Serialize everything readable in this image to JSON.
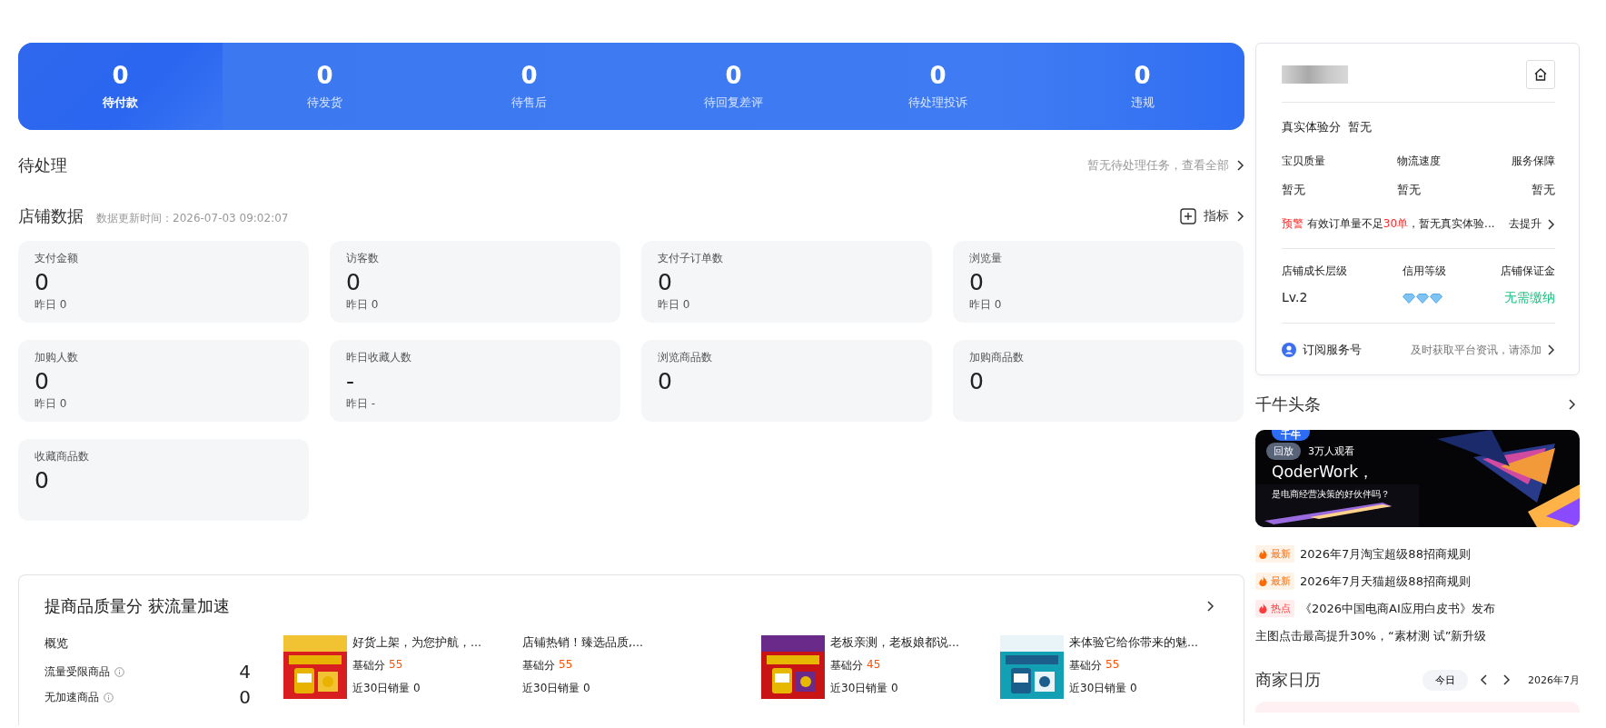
{
  "summary": [
    {
      "value": "0",
      "label": "待付款",
      "selected": true
    },
    {
      "value": "0",
      "label": "待发货",
      "selected": false
    },
    {
      "value": "0",
      "label": "待售后",
      "selected": false
    },
    {
      "value": "0",
      "label": "待回复差评",
      "selected": false
    },
    {
      "value": "0",
      "label": "待处理投诉",
      "selected": false
    },
    {
      "value": "0",
      "label": "违规",
      "selected": false
    }
  ],
  "pending": {
    "title": "待处理",
    "link": "暂无待处理任务，查看全部"
  },
  "store_data": {
    "title": "店铺数据",
    "updated": "数据更新时间：2026-07-03 09:02:07",
    "metric_button": "指标"
  },
  "metrics": [
    {
      "label": "支付金额",
      "value": "0",
      "yesterday": "昨日 0"
    },
    {
      "label": "访客数",
      "value": "0",
      "yesterday": "昨日 0"
    },
    {
      "label": "支付子订单数",
      "value": "0",
      "yesterday": "昨日 0"
    },
    {
      "label": "浏览量",
      "value": "0",
      "yesterday": "昨日 0"
    },
    {
      "label": "加购人数",
      "value": "0",
      "yesterday": "昨日 0"
    },
    {
      "label": "昨日收藏人数",
      "value": "-",
      "yesterday": "昨日 -"
    },
    {
      "label": "浏览商品数",
      "value": "0"
    },
    {
      "label": "加购商品数",
      "value": "0"
    },
    {
      "label": "收藏商品数",
      "value": "0"
    }
  ],
  "quality": {
    "title": "提商品质量分 获流量加速",
    "overview_title": "概览",
    "overview": [
      {
        "label": "流量受限商品",
        "value": "4"
      },
      {
        "label": "无加速商品",
        "value": "0"
      }
    ],
    "products": [
      {
        "title": "好货上架，为您护航，...",
        "score_label": "基础分",
        "score": "55",
        "sales": "近30日销量 0"
      },
      {
        "title": "店铺热销！臻选品质,...",
        "score_label": "基础分",
        "score": "55",
        "sales": "近30日销量 0"
      },
      {
        "title": "老板亲测，老板娘都说...",
        "score_label": "基础分",
        "score": "45",
        "sales": "近30日销量 0"
      },
      {
        "title": "来体验它给你带来的魅...",
        "score_label": "基础分",
        "score": "55",
        "sales": "近30日销量 0"
      }
    ]
  },
  "profile": {
    "experience_label": "真实体验分",
    "experience_value": "暂无",
    "scores": [
      {
        "label": "宝贝质量",
        "value": "暂无"
      },
      {
        "label": "物流速度",
        "value": "暂无"
      },
      {
        "label": "服务保障",
        "value": "暂无"
      }
    ],
    "warning": {
      "tag": "预警",
      "text_before": "有效订单量不足",
      "highlight": "30单",
      "text_after": "，暂无真实体验...",
      "action": "去提升"
    },
    "levels": [
      {
        "label": "店铺成长层级",
        "value": "Lv.2",
        "kind": "text"
      },
      {
        "label": "信用等级",
        "kind": "diamonds",
        "stars": 3
      },
      {
        "label": "店铺保证金",
        "value": "无需缴纳",
        "kind": "status"
      }
    ],
    "subscribe": {
      "label": "订阅服务号",
      "hint": "及时获取平台资讯，请添加"
    }
  },
  "headlines": {
    "title": "千牛头条",
    "banner": {
      "logo": "千牛",
      "badge": "回放",
      "viewers": "3万人观看",
      "heading": "QoderWork，",
      "subheading": "是电商经营决策的好伙伴吗？"
    },
    "items": [
      {
        "tag": "最新",
        "kind": "new",
        "text": "2026年7月淘宝超级88招商规则"
      },
      {
        "tag": "最新",
        "kind": "new",
        "text": "2026年7月天猫超级88招商规则"
      },
      {
        "tag": "热点",
        "kind": "hot",
        "text": "《2026中国电商AI应用白皮书》发布"
      },
      {
        "kind": "plain",
        "text": "主图点击最高提升30%，“素材测 试”新升级"
      }
    ]
  },
  "calendar": {
    "title": "商家日历",
    "today": "今日",
    "month": "2026年7月"
  }
}
